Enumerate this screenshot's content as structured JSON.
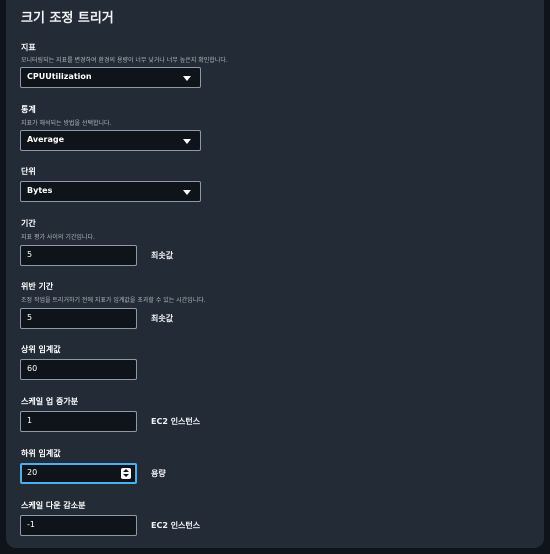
{
  "title": "크기 조정 트리거",
  "metric": {
    "label": "지표",
    "description": "모니터링되는 지표를 변경하여 환경의 용량이 너무 낮거나 너무 높은지 확인합니다.",
    "value": "CPUUtilization"
  },
  "statistic": {
    "label": "통계",
    "description": "지표가 해석되는 방법을 선택합니다.",
    "value": "Average"
  },
  "unit": {
    "label": "단위",
    "value": "Bytes"
  },
  "period": {
    "label": "기간",
    "description": "지표 평가 사이의 기간입니다.",
    "value": "5",
    "unit": "최솟값"
  },
  "breach_duration": {
    "label": "위반 기간",
    "description": "조정 작업을 트리거하기 전에 지표가 임계값을 초과할 수 있는 시간입니다.",
    "value": "5",
    "unit": "최솟값"
  },
  "upper_threshold": {
    "label": "상위 임계값",
    "value": "60"
  },
  "scale_up_increment": {
    "label": "스케일 업 증가분",
    "value": "1",
    "unit": "EC2 인스턴스"
  },
  "lower_threshold": {
    "label": "하위 임계값",
    "value": "20",
    "unit": "용량"
  },
  "scale_down_increment": {
    "label": "스케일 다운 감소분",
    "value": "-1",
    "unit": "EC2 인스턴스"
  }
}
